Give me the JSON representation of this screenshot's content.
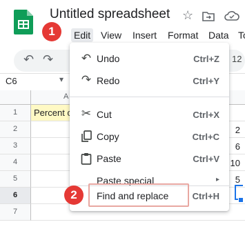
{
  "header": {
    "title": "Untitled spreadsheet",
    "icons": [
      "sheets-logo",
      "star-icon",
      "move-folder-icon",
      "cloud-save-icon"
    ]
  },
  "menubar": [
    "Edit",
    "View",
    "Insert",
    "Format",
    "Data",
    "To"
  ],
  "toolbar": {
    "icons": [
      "undo-icon",
      "redo-icon"
    ],
    "partial_value": "12"
  },
  "formula_bar": {
    "name_box": "C6"
  },
  "grid": {
    "column_partial": "A",
    "row_numbers": [
      "1",
      "2",
      "3",
      "4",
      "5",
      "6",
      "7"
    ],
    "a1_text": "Percent c",
    "right_values": [
      "2",
      "6",
      "10",
      "5"
    ]
  },
  "edit_menu": {
    "items": [
      {
        "label": "Undo",
        "shortcut": "Ctrl+Z",
        "icon": "undo-icon"
      },
      {
        "label": "Redo",
        "shortcut": "Ctrl+Y",
        "icon": "redo-icon"
      },
      {
        "label": "Cut",
        "shortcut": "Ctrl+X",
        "icon": "scissors-icon"
      },
      {
        "label": "Copy",
        "shortcut": "Ctrl+C",
        "icon": "copy-icon"
      },
      {
        "label": "Paste",
        "shortcut": "Ctrl+V",
        "icon": "clipboard-icon"
      },
      {
        "label": "Paste special",
        "shortcut": "▸",
        "icon": ""
      },
      {
        "label": "Find and replace",
        "shortcut": "Ctrl+H",
        "icon": ""
      }
    ]
  },
  "callouts": [
    "1",
    "2"
  ],
  "colors": {
    "accent": "#1a73e8",
    "callout": "#e53935",
    "highlight": "#fff9c4",
    "sheets_green": "#0f9d58"
  }
}
